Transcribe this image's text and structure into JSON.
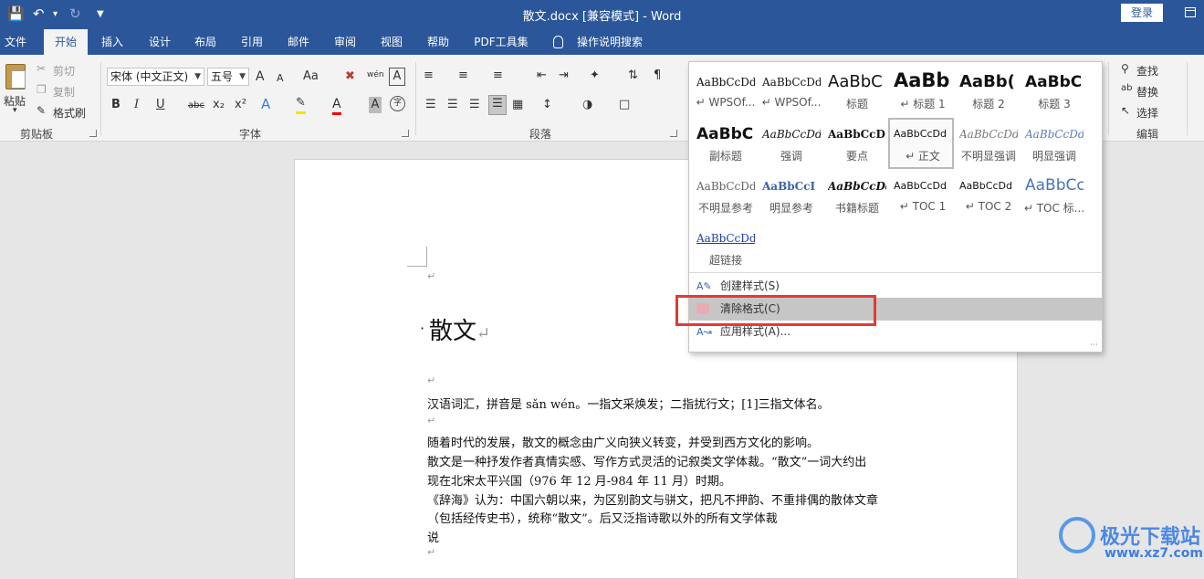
{
  "titlebar": {
    "title": "散文.docx [兼容模式]  -  Word",
    "login": "登录",
    "save_icon": "save-icon",
    "undo_icon": "undo-icon",
    "redo_icon": "redo-icon"
  },
  "tabs": [
    "文件",
    "开始",
    "插入",
    "设计",
    "布局",
    "引用",
    "邮件",
    "审阅",
    "视图",
    "帮助",
    "PDF工具集",
    "操作说明搜索"
  ],
  "active_tab": "开始",
  "clipboard": {
    "paste": "粘贴",
    "cut": "剪切",
    "copy": "复制",
    "format_painter": "格式刷",
    "group": "剪贴板"
  },
  "font": {
    "name": "宋体 (中文正文)",
    "size": "五号",
    "group": "字体",
    "case_button": "Aa",
    "bold": "B",
    "italic": "I",
    "underline": "U",
    "strike": "abc",
    "sub": "x₂",
    "sup": "x²",
    "text_effect": "A",
    "char_border": "A",
    "phonetic": "wén",
    "grow": "A",
    "shrink": "A",
    "shade": "A",
    "encircle": "字"
  },
  "paragraph": {
    "group": "段落"
  },
  "editing": {
    "find": "查找",
    "replace": "替换",
    "select": "选择",
    "group": "编辑"
  },
  "document": {
    "title": "散文",
    "lines": [
      "汉语词汇，拼音是 sǎn wén。一指文采焕发；二指扰行文；[1]三指文体名。",
      "随着时代的发展，散文的概念由广义向狭义转变，并受到西方文化的影响。",
      "散文是一种抒发作者真情实感、写作方式灵活的记叙类文学体裁。“散文”一词大约出",
      "现在北宋太平兴国（976 年 12 月-984 年 11 月）时期。",
      "《辞海》认为：中国六朝以来，为区别韵文与骈文，把凡不押韵、不重排偶的散体文章",
      "（包括经传史书），统称“散文”。后又泛指诗歌以外的所有文学体裁",
      "说"
    ],
    "para_mark": "↵"
  },
  "styles_gallery": {
    "rows": [
      [
        {
          "preview": "AaBbCcDd",
          "name": "↵ WPSOf..."
        },
        {
          "preview": "AaBbCcDd",
          "name": "↵ WPSOf..."
        },
        {
          "preview": "AaBbC",
          "name": "标题"
        },
        {
          "preview": "AaBb",
          "name": "↵ 标题 1"
        },
        {
          "preview": "AaBb(",
          "name": "标题 2"
        },
        {
          "preview": "AaBbC",
          "name": "标题 3"
        }
      ],
      [
        {
          "preview": "AaBbC",
          "name": "副标题"
        },
        {
          "preview": "AaBbCcDd",
          "name": "强调"
        },
        {
          "preview": "AaBbCcD",
          "name": "要点"
        },
        {
          "preview": "AaBbCcDd",
          "name": "↵ 正文"
        },
        {
          "preview": "AaBbCcDd",
          "name": "不明显强调"
        },
        {
          "preview": "AaBbCcDd",
          "name": "明显强调"
        }
      ],
      [
        {
          "preview": "AaBbCcDd",
          "name": "不明显参考"
        },
        {
          "preview": "AaBbCcI",
          "name": "明显参考"
        },
        {
          "preview": "AaBbCcDd",
          "name": "书籍标题"
        },
        {
          "preview": "AaBbCcDd",
          "name": "↵ TOC 1"
        },
        {
          "preview": "AaBbCcDd",
          "name": "↵ TOC 2"
        },
        {
          "preview": "AaBbCc",
          "name": "↵ TOC 标..."
        }
      ],
      [
        {
          "preview": "AaBbCcDd",
          "name": "超链接"
        }
      ]
    ],
    "menu": {
      "create": "创建样式(S)",
      "clear": "清除格式(C)",
      "apply": "应用样式(A)..."
    }
  },
  "watermark": {
    "brand": "极光下载站",
    "url": "www.xz7.com"
  }
}
